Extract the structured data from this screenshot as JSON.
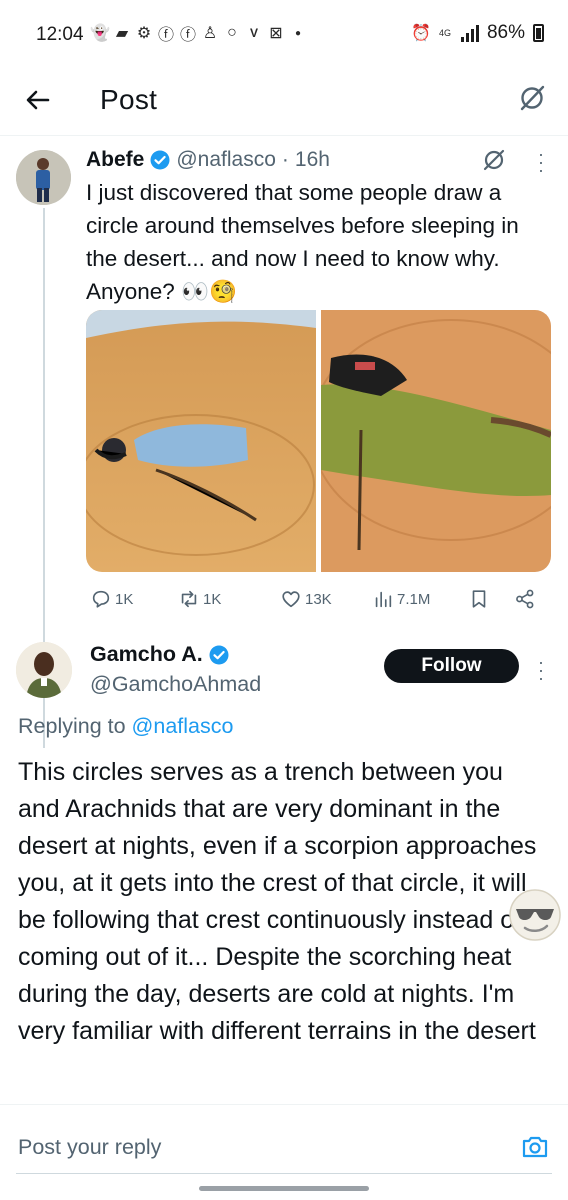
{
  "status_bar": {
    "time": "12:04",
    "battery": "86%",
    "network": "4G",
    "icons": [
      "snapchat-icon",
      "message-icon",
      "settings-icon",
      "facebook-icon",
      "facebook-icon",
      "add-user-icon",
      "circle-icon",
      "vodafone-icon",
      "x-icon",
      "dot-icon",
      "alarm-icon",
      "data-icon",
      "signal-icon",
      "battery-icon"
    ]
  },
  "header": {
    "title": "Post"
  },
  "tweet": {
    "author_name": "Abefe",
    "handle": "@naflasco",
    "time": "16h",
    "text": "I just discovered that some people draw a circle around themselves before sleeping in the desert... and now I need to know why. Anyone? 👀🧐",
    "metrics": {
      "replies": "1K",
      "reposts": "1K",
      "likes": "13K",
      "views": "7.1M"
    }
  },
  "reply": {
    "author_name": "Gamcho A.",
    "handle": "@GamchoAhmad",
    "follow_label": "Follow",
    "replying_prefix": "Replying to ",
    "replying_handle": "@naflasco",
    "text": "This circles serves as a trench between you and Arachnids that are very dominant in the desert at nights, even if a scorpion approaches you, at it gets into the crest of that circle, it will be following that crest continuously instead of coming out of it... Despite the scorching heat during the day, deserts are cold at nights. I'm very familiar with different terrains in the desert"
  },
  "composer": {
    "placeholder": "Post your reply"
  },
  "colors": {
    "accent": "#1d9bf0",
    "text": "#0f1419",
    "secondary": "#536471",
    "sand": "#d9a25c"
  }
}
